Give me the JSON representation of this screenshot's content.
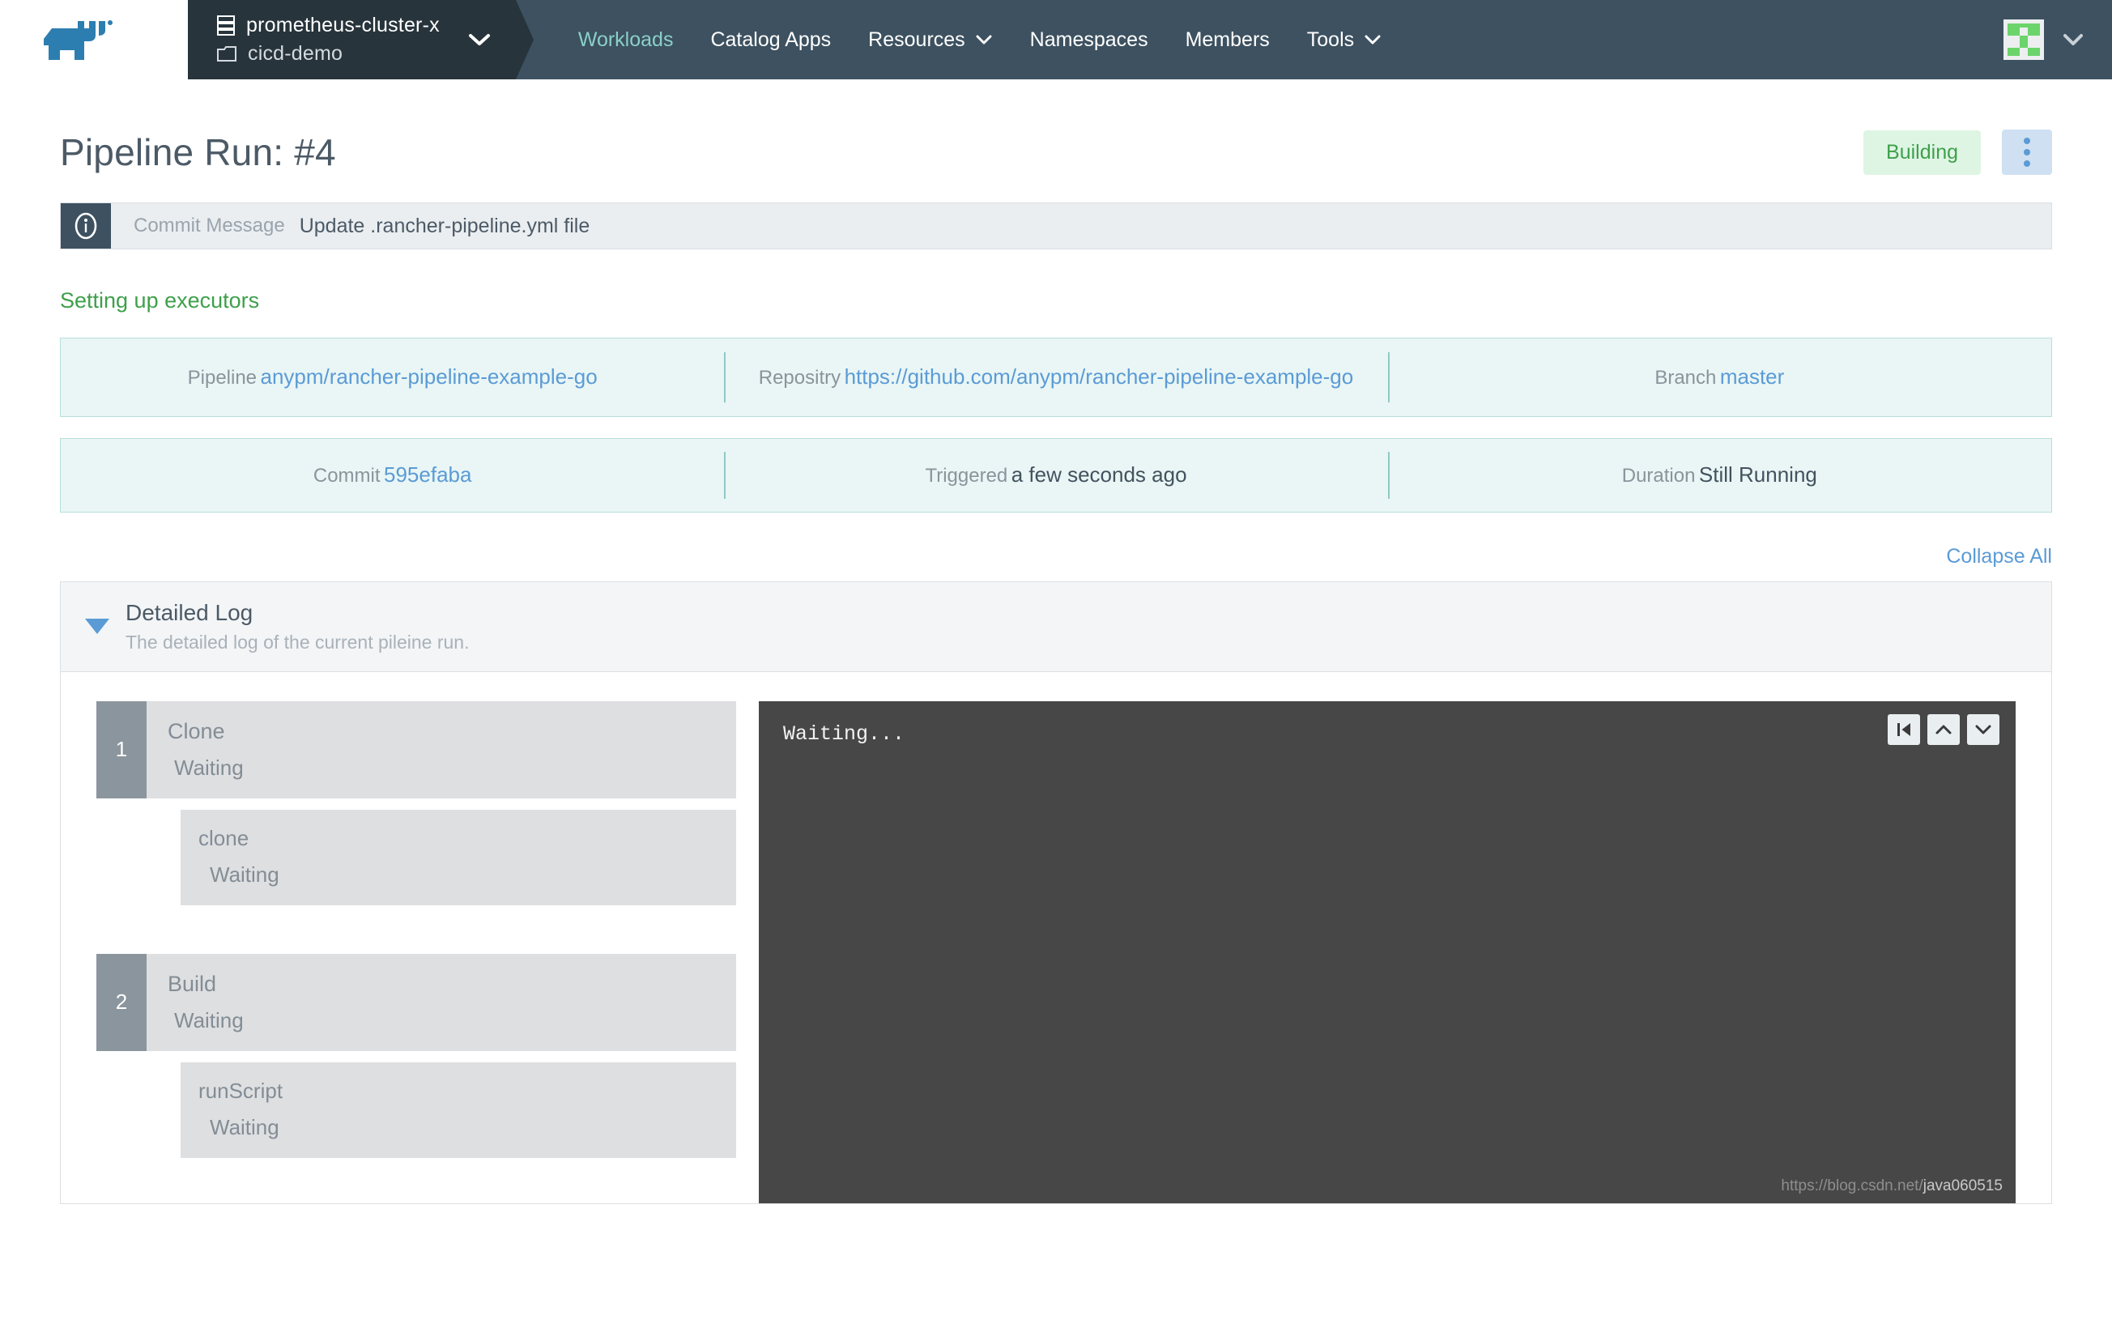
{
  "header": {
    "logo_name": "rancher-logo",
    "cluster": "prometheus-cluster-x",
    "project": "cicd-demo",
    "nav_items": [
      {
        "label": "Workloads",
        "active": true,
        "caret": false
      },
      {
        "label": "Catalog Apps",
        "active": false,
        "caret": false
      },
      {
        "label": "Resources",
        "active": false,
        "caret": true
      },
      {
        "label": "Namespaces",
        "active": false,
        "caret": false
      },
      {
        "label": "Members",
        "active": false,
        "caret": false
      },
      {
        "label": "Tools",
        "active": false,
        "caret": true
      }
    ]
  },
  "page": {
    "title": "Pipeline Run: #4",
    "status_badge": "Building",
    "commit_banner": {
      "label": "Commit Message",
      "value": "Update .rancher-pipeline.yml file"
    },
    "stage_message": "Setting up executors",
    "info_rows": [
      [
        {
          "label": "Pipeline",
          "value": "anypm/rancher-pipeline-example-go",
          "kind": "link"
        },
        {
          "label": "Repositry",
          "value": "https://github.com/anypm/rancher-pipeline-example-go",
          "kind": "link"
        },
        {
          "label": "Branch",
          "value": "master",
          "kind": "link"
        }
      ],
      [
        {
          "label": "Commit",
          "value": "595efaba",
          "kind": "link"
        },
        {
          "label": "Triggered",
          "value": "a few seconds ago",
          "kind": "strong"
        },
        {
          "label": "Duration",
          "value": "Still Running",
          "kind": "strong"
        }
      ]
    ],
    "collapse_all": "Collapse All",
    "detailed_log": {
      "title": "Detailed Log",
      "subtitle": "The detailed log of the current pileine run.",
      "stages": [
        {
          "number": "1",
          "name": "Clone",
          "status": "Waiting",
          "steps": [
            {
              "name": "clone",
              "status": "Waiting"
            }
          ]
        },
        {
          "number": "2",
          "name": "Build",
          "status": "Waiting",
          "steps": [
            {
              "name": "runScript",
              "status": "Waiting"
            }
          ]
        }
      ],
      "console_output": "Waiting...",
      "console_buttons": [
        "skip-to-start-icon",
        "scroll-up-icon",
        "scroll-down-icon"
      ]
    }
  },
  "watermark": {
    "url": "https://blog.csdn.net/",
    "user": "java060515"
  },
  "colors": {
    "nav_bg": "#3d5160",
    "chip_bg": "#27343b",
    "accent_active": "#8ad0c8",
    "link": "#5b9bd5",
    "success": "#3fa04b",
    "badge_bg": "#def5e4",
    "info_card_bg": "#e9f6f5",
    "info_card_border": "#b9dedd",
    "stage_bg": "#dedfe1",
    "stage_num_bg": "#8b959d",
    "console_bg": "#474747"
  }
}
